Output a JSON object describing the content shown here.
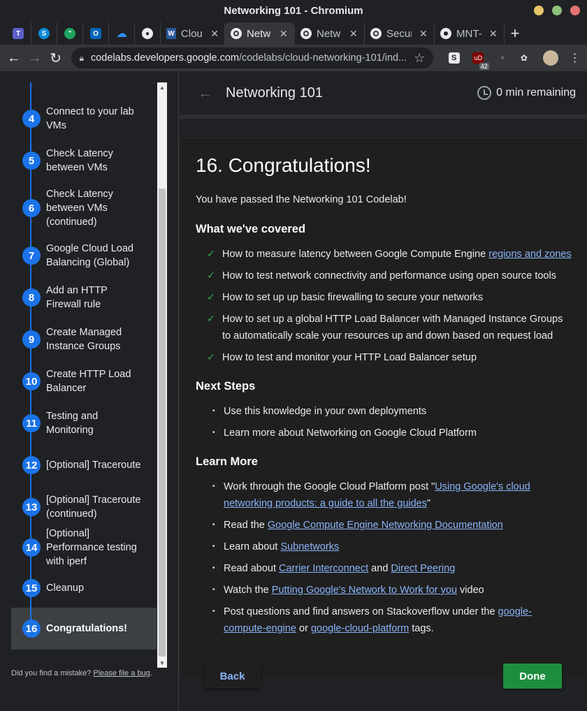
{
  "window": {
    "title": "Networking 101 - Chromium"
  },
  "tabs": [
    {
      "label": "Cloud",
      "icon": "word-icon"
    },
    {
      "label": "Netw",
      "icon": "globe-icon",
      "active": true
    },
    {
      "label": "Netw",
      "icon": "globe-icon"
    },
    {
      "label": "Secur",
      "icon": "globe-icon"
    },
    {
      "label": "MNT-",
      "icon": "github-icon"
    }
  ],
  "toolbar": {
    "url_host": "codelabs.developers.google.com",
    "url_path": "/codelabs/cloud-networking-101/ind...",
    "ext_badge": "42"
  },
  "sidebar": {
    "steps": [
      {
        "num": "4",
        "label": "Connect to your lab VMs"
      },
      {
        "num": "5",
        "label": "Check Latency between VMs"
      },
      {
        "num": "6",
        "label": "Check Latency between VMs (continued)"
      },
      {
        "num": "7",
        "label": "Google Cloud Load Balancing (Global)"
      },
      {
        "num": "8",
        "label": "Add an HTTP Firewall rule"
      },
      {
        "num": "9",
        "label": "Create Managed Instance Groups"
      },
      {
        "num": "10",
        "label": "Create HTTP Load Balancer"
      },
      {
        "num": "11",
        "label": "Testing and Monitoring"
      },
      {
        "num": "12",
        "label": "[Optional] Traceroute"
      },
      {
        "num": "13",
        "label": "[Optional] Traceroute (continued)"
      },
      {
        "num": "14",
        "label": "[Optional] Performance testing with iperf"
      },
      {
        "num": "15",
        "label": "Cleanup"
      },
      {
        "num": "16",
        "label": "Congratulations!",
        "current": true
      }
    ],
    "mistake_text": "Did you find a mistake?",
    "mistake_link": "Please file a bug"
  },
  "header": {
    "title": "Networking 101",
    "timer": "0 min remaining"
  },
  "content": {
    "heading": "16. Congratulations!",
    "intro": "You have passed the Networking 101 Codelab!",
    "covered_title": "What we've covered",
    "covered": [
      {
        "text": "How to measure latency between Google Compute Engine ",
        "link": "regions and zones"
      },
      {
        "text": "How to test network connectivity and performance using open source tools"
      },
      {
        "text": "How to set up up basic firewalling to secure your networks"
      },
      {
        "text": "How to set up a global HTTP Load Balancer with Managed Instance Groups to automatically scale your resources up and down based on request load"
      },
      {
        "text": "How to test and monitor your HTTP Load Balancer setup"
      }
    ],
    "next_title": "Next Steps",
    "next": [
      "Use this knowledge in your own deployments",
      "Learn more about Networking on Google Cloud Platform"
    ],
    "learn_title": "Learn More",
    "learn": {
      "l1_pre": "Work through the Google Cloud Platform post \"",
      "l1_link": "Using Google's cloud networking products: a guide to all the guides",
      "l1_post": "\"",
      "l2_pre": "Read the ",
      "l2_link": "Google Compute Engine Networking Documentation",
      "l3_pre": "Learn about ",
      "l3_link": "Subnetworks",
      "l4_pre": "Read about ",
      "l4_link1": "Carrier Interconnect",
      "l4_mid": " and ",
      "l4_link2": "Direct Peering",
      "l5_pre": "Watch the ",
      "l5_link": "Putting Google's Network to Work for you",
      "l5_post": " video",
      "l6_pre": "Post questions and find answers on Stackoverflow under the ",
      "l6_link1": "google-compute-engine",
      "l6_mid": " or ",
      "l6_link2": "google-cloud-platform",
      "l6_post": " tags."
    }
  },
  "buttons": {
    "back": "Back",
    "done": "Done"
  },
  "colors": {
    "accent": "#1a73e8",
    "done": "#1e8e3e",
    "link": "#8ab4f8",
    "check": "#34a853"
  }
}
